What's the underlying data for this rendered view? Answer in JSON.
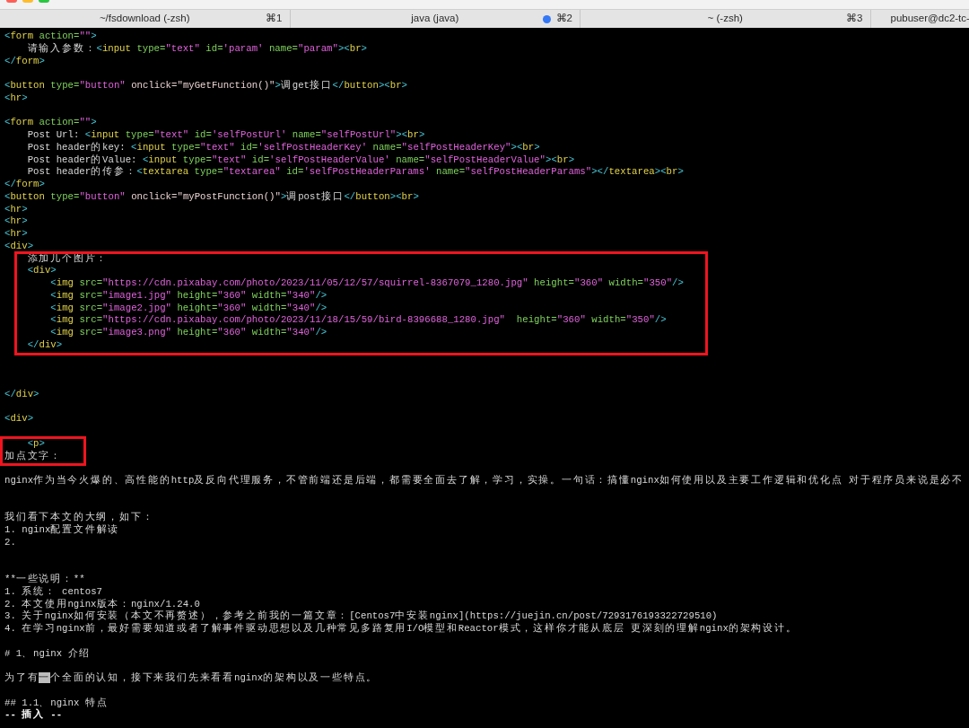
{
  "tabs": [
    {
      "title": "~/fsdownload (-zsh)",
      "shortcut": "⌘1",
      "activity": false
    },
    {
      "title": "java (java)",
      "shortcut": "⌘2",
      "activity": true
    },
    {
      "title": "~ (-zsh)",
      "shortcut": "⌘3",
      "activity": false
    },
    {
      "title": "pubuser@dc2-tc-",
      "activity": false
    }
  ],
  "editor": {
    "lines": [
      {
        "kind": "code",
        "text": "<form action=\"\">"
      },
      {
        "kind": "code",
        "text": "    请输入参数：<input type=\"text\" id='param' name=\"param\"><br>"
      },
      {
        "kind": "code",
        "text": "</form>"
      },
      {
        "kind": "blank"
      },
      {
        "kind": "code",
        "text": "<button type=\"button\" onclick=\"myGetFunction()\">调get接口</button><br>"
      },
      {
        "kind": "code",
        "text": "<hr>"
      },
      {
        "kind": "blank"
      },
      {
        "kind": "code",
        "text": "<form action=\"\">"
      },
      {
        "kind": "code",
        "text": "    Post Url: <input type=\"text\" id='selfPostUrl' name=\"selfPostUrl\"><br>"
      },
      {
        "kind": "code",
        "text": "    Post header的key: <input type=\"text\" id='selfPostHeaderKey' name=\"selfPostHeaderKey\"><br>"
      },
      {
        "kind": "code",
        "text": "    Post header的Value: <input type=\"text\" id='selfPostHeaderValue' name=\"selfPostHeaderValue\"><br>"
      },
      {
        "kind": "code",
        "text": "    Post header的传参：<textarea type=\"textarea\" id='selfPostHeaderParams' name=\"selfPostHeaderParams\"></textarea><br>"
      },
      {
        "kind": "code",
        "text": "</form>"
      },
      {
        "kind": "code",
        "text": "<button type=\"button\" onclick=\"myPostFunction()\">调post接口</button><br>"
      },
      {
        "kind": "code",
        "text": "<hr>"
      },
      {
        "kind": "code",
        "text": "<hr>"
      },
      {
        "kind": "code",
        "text": "<hr>"
      },
      {
        "kind": "code",
        "text": "<div>"
      },
      {
        "kind": "annotation",
        "lines": [
          {
            "kind": "code",
            "text": "    添加几个图片："
          },
          {
            "kind": "code",
            "text": "    <div>"
          },
          {
            "kind": "code",
            "text": "        <img src=\"https://cdn.pixabay.com/photo/2023/11/05/12/57/squirrel-8367079_1280.jpg\" height=\"360\" width=\"350\"/>"
          },
          {
            "kind": "code",
            "text": "        <img src=\"image1.jpg\" height=\"360\" width=\"340\"/>"
          },
          {
            "kind": "code",
            "text": "        <img src=\"image2.jpg\" height=\"360\" width=\"340\"/>"
          },
          {
            "kind": "code",
            "text": "        <img src=\"https://cdn.pixabay.com/photo/2023/11/18/15/59/bird-8396688_1280.jpg\"  height=\"360\" width=\"350\"/>"
          },
          {
            "kind": "code",
            "text": "        <img src=\"image3.png\" height=\"360\" width=\"340\"/>"
          },
          {
            "kind": "code",
            "text": "    </div>"
          }
        ]
      },
      {
        "kind": "blank"
      },
      {
        "kind": "blank"
      },
      {
        "kind": "blank"
      },
      {
        "kind": "code",
        "text": "</div>"
      },
      {
        "kind": "blank"
      },
      {
        "kind": "code",
        "text": "<div>"
      },
      {
        "kind": "blank"
      },
      {
        "kind": "annotation",
        "lines": [
          {
            "kind": "code",
            "text": "    <p>"
          },
          {
            "kind": "code",
            "text": "加点文字："
          }
        ]
      },
      {
        "kind": "blank"
      },
      {
        "kind": "text",
        "text": "nginx作为当今火爆的、高性能的http及反向代理服务，不管前端还是后端，都需要全面去了解，学习，实操。一句话：搞懂nginx如何使用以及主要工作逻辑和优化点 对于程序员来说是必不"
      },
      {
        "kind": "blank"
      },
      {
        "kind": "blank"
      },
      {
        "kind": "text",
        "text": "我们看下本文的大纲，如下："
      },
      {
        "kind": "text",
        "text": "1. nginx配置文件解读"
      },
      {
        "kind": "text",
        "text": "2."
      },
      {
        "kind": "blank"
      },
      {
        "kind": "blank"
      },
      {
        "kind": "parts_text",
        "parts": [
          "**",
          "一些说明：",
          "**"
        ]
      },
      {
        "kind": "text",
        "text": "1. 系统： centos7"
      },
      {
        "kind": "text",
        "text": "2. 本文使用nginx版本：nginx/1.24.0"
      },
      {
        "kind": "text",
        "text": "3. 关于nginx如何安装（本文不再赘述），参考之前我的一篇文章：[Centos7中安装nginx](https://juejin.cn/post/7293176193322729510)"
      },
      {
        "kind": "text",
        "text": "4. 在学习nginx前，最好需要知道或者了解事件驱动思想以及几种常见多路复用I/O模型和Reactor模式，这样你才能从底层 更深刻的理解nginx的架构设计。"
      },
      {
        "kind": "blank"
      },
      {
        "kind": "text",
        "text": "# 1、nginx 介绍"
      },
      {
        "kind": "blank"
      },
      {
        "kind": "cursor_text",
        "before": "为了有",
        "cursor": "一",
        "after": "个全面的认知，接下来我们先来看看nginx的架构以及一些特点。"
      },
      {
        "kind": "blank"
      },
      {
        "kind": "text",
        "text": "## 1.1、nginx 特点"
      }
    ],
    "mode_message": "-- 插入 --"
  }
}
